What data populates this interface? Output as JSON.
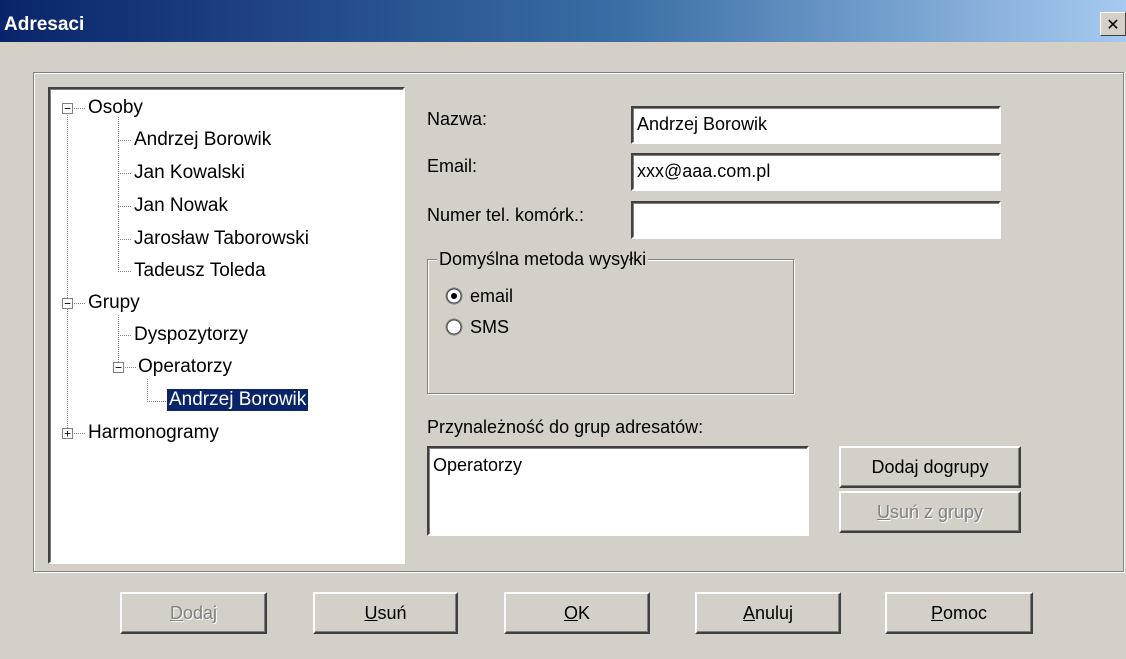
{
  "window": {
    "title": "Adresaci",
    "close_glyph": "✕"
  },
  "tree": {
    "osoby": "Osoby",
    "osoby_items": [
      "Andrzej Borowik",
      "Jan Kowalski",
      "Jan Nowak",
      "Jarosław Taborowski",
      "Tadeusz Toleda"
    ],
    "grupy": "Grupy",
    "dyspozytorzy": "Dyspozytorzy",
    "operatorzy": "Operatorzy",
    "operatorzy_member": "Andrzej Borowik",
    "harmonogramy": "Harmonogramy",
    "minus": "−",
    "plus": "+"
  },
  "form": {
    "nazwa_label": "Nazwa:",
    "nazwa_value": "Andrzej Borowik",
    "email_label": "Email:",
    "email_value": "xxx@aaa.com.pl",
    "tel_label": "Numer tel. komórk.:",
    "tel_value": "",
    "send_method": {
      "legend": "Domyślna metoda wysyłki",
      "options": [
        "email",
        "SMS"
      ],
      "selected": "email"
    },
    "groups_label": "Przynależność do grup adresatów:",
    "groups": [
      "Operatorzy"
    ]
  },
  "group_buttons": {
    "add_prefix": "Dodaj do ",
    "add_accel": "g",
    "add_suffix": "rupy",
    "remove_accel": "U",
    "remove_rest": "suń z grupy"
  },
  "buttons": {
    "dodaj_accel": "D",
    "dodaj_rest": "odaj",
    "usun_accel": "U",
    "usun_rest": "suń",
    "ok_accel": "O",
    "ok_rest": "K",
    "anuluj_accel": "A",
    "anuluj_rest": "nuluj",
    "pomoc_accel": "P",
    "pomoc_rest": "omoc"
  }
}
